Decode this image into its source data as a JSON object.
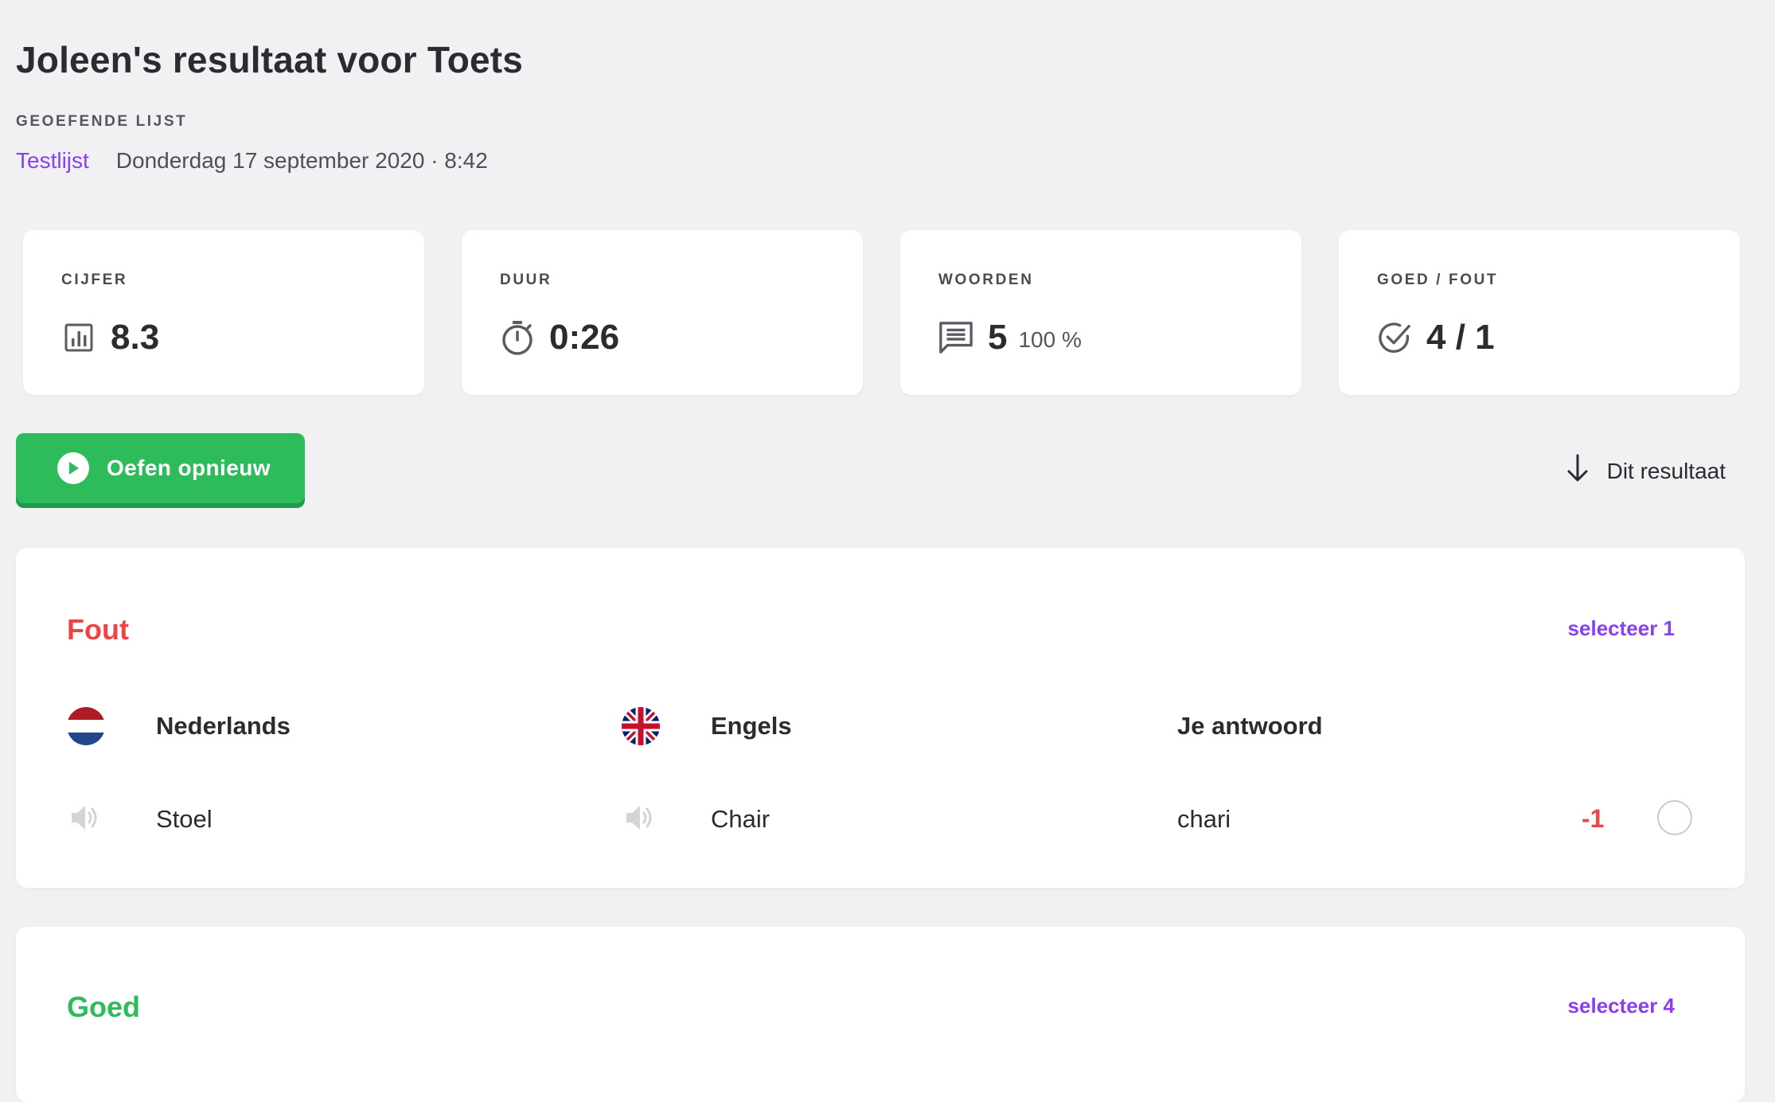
{
  "header": {
    "title": "Joleen's resultaat voor Toets",
    "list_label": "GEOEFENDE LIJST",
    "list_name": "Testlijst",
    "date": "Donderdag 17 september 2020 · 8:42"
  },
  "stats": [
    {
      "label": "CIJFER",
      "value": "8.3",
      "sub": "",
      "icon": "bar-chart-icon"
    },
    {
      "label": "DUUR",
      "value": "0:26",
      "sub": "",
      "icon": "stopwatch-icon"
    },
    {
      "label": "WOORDEN",
      "value": "5",
      "sub": "100 %",
      "icon": "message-icon"
    },
    {
      "label": "GOED / FOUT",
      "value": "4 / 1",
      "sub": "",
      "icon": "check-circle-icon"
    }
  ],
  "actions": {
    "practice_again": "Oefen opnieuw",
    "download": "Dit resultaat"
  },
  "sections": {
    "wrong": {
      "title": "Fout",
      "select_label": "selecteer 1",
      "color": "#f04444",
      "columns": [
        "Nederlands",
        "Engels",
        "Je antwoord"
      ],
      "rows": [
        {
          "source": "Stoel",
          "target": "Chair",
          "answer": "chari",
          "penalty": "-1"
        }
      ]
    },
    "right": {
      "title": "Goed",
      "select_label": "selecteer 4",
      "color": "#2dbb5c"
    }
  },
  "colors": {
    "accent": "#8a3ff0",
    "primary_button": "#2dbb5c",
    "background": "#f1f1f3"
  }
}
